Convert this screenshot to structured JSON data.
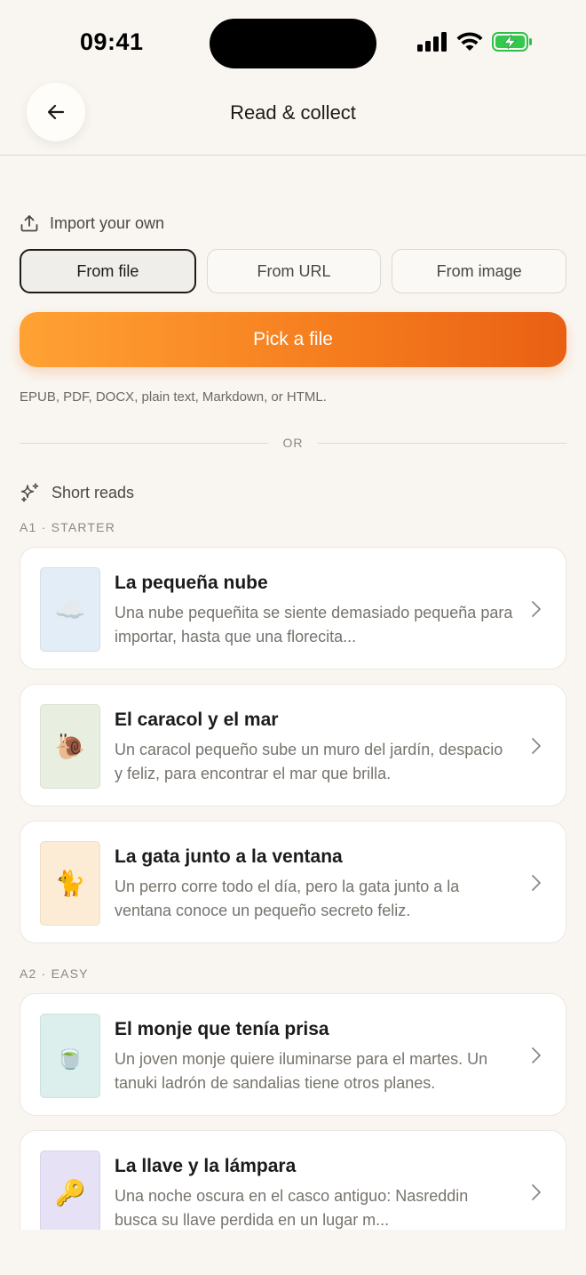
{
  "status_bar": {
    "time": "09:41"
  },
  "header": {
    "title": "Read & collect"
  },
  "import": {
    "label": "Import your own",
    "tabs": [
      {
        "label": "From file",
        "active": true
      },
      {
        "label": "From URL",
        "active": false
      },
      {
        "label": "From image",
        "active": false
      }
    ],
    "pick_button": "Pick a file",
    "formats_note": "EPUB, PDF, DOCX, plain text, Markdown, or HTML."
  },
  "divider_text": "OR",
  "short_reads": {
    "label": "Short reads",
    "levels": [
      {
        "label": "A1 · STARTER",
        "items": [
          {
            "title": "La pequeña nube",
            "description": "Una nube pequeñita se siente demasiado pequeña para importar, hasta que una florecita...",
            "icon": "☁️",
            "thumb_color": "#e3edf7"
          },
          {
            "title": "El caracol y el mar",
            "description": "Un caracol pequeño sube un muro del jardín, despacio y feliz, para encontrar el mar que brilla.",
            "icon": "🐌",
            "thumb_color": "#e9efe0"
          },
          {
            "title": "La gata junto a la ventana",
            "description": "Un perro corre todo el día, pero la gata junto a la ventana conoce un pequeño secreto feliz.",
            "icon": "🐈",
            "thumb_color": "#fdecd5"
          }
        ]
      },
      {
        "label": "A2 · EASY",
        "items": [
          {
            "title": "El monje que tenía prisa",
            "description": "Un joven monje quiere iluminarse para el martes. Un tanuki ladrón de sandalias tiene otros planes.",
            "icon": "🍵",
            "thumb_color": "#dcefec"
          },
          {
            "title": "La llave y la lámpara",
            "description": "Una noche oscura en el casco antiguo: Nasreddin busca su llave perdida en un lugar m...",
            "icon": "🔑",
            "thumb_color": "#e6e1f5"
          }
        ]
      }
    ]
  },
  "colors": {
    "accent_start": "#ffa234",
    "accent_end": "#e96014",
    "background": "#f9f6f1"
  }
}
